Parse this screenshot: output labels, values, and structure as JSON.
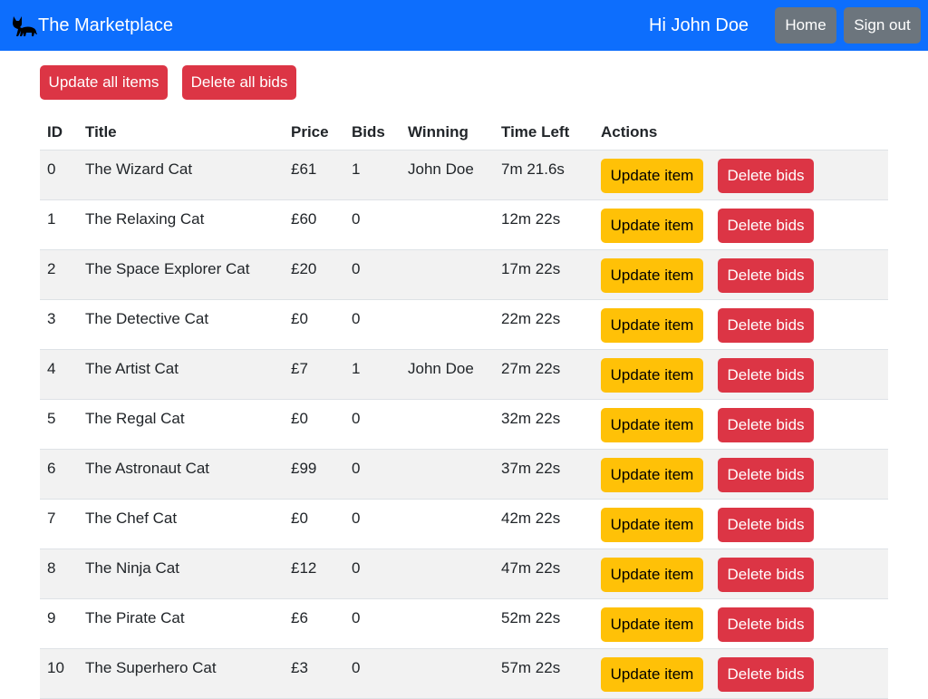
{
  "navbar": {
    "brand": "The Marketplace",
    "brand_icon": "cat-icon",
    "greeting": "Hi John Doe",
    "home_label": "Home",
    "signout_label": "Sign out",
    "color": "#0d6efd"
  },
  "toolbar": {
    "update_all_label": "Update all items",
    "delete_all_label": "Delete all bids"
  },
  "table": {
    "headers": [
      "ID",
      "Title",
      "Price",
      "Bids",
      "Winning",
      "Time Left",
      "Actions"
    ],
    "rows": [
      {
        "id": "0",
        "title": "The Wizard Cat",
        "price": "£61",
        "bids": "1",
        "winning": "John Doe",
        "time_left": "7m 21.6s"
      },
      {
        "id": "1",
        "title": "The Relaxing Cat",
        "price": "£60",
        "bids": "0",
        "winning": "",
        "time_left": "12m 22s"
      },
      {
        "id": "2",
        "title": "The Space Explorer Cat",
        "price": "£20",
        "bids": "0",
        "winning": "",
        "time_left": "17m 22s"
      },
      {
        "id": "3",
        "title": "The Detective Cat",
        "price": "£0",
        "bids": "0",
        "winning": "",
        "time_left": "22m 22s"
      },
      {
        "id": "4",
        "title": "The Artist Cat",
        "price": "£7",
        "bids": "1",
        "winning": "John Doe",
        "time_left": "27m 22s"
      },
      {
        "id": "5",
        "title": "The Regal Cat",
        "price": "£0",
        "bids": "0",
        "winning": "",
        "time_left": "32m 22s"
      },
      {
        "id": "6",
        "title": "The Astronaut Cat",
        "price": "£99",
        "bids": "0",
        "winning": "",
        "time_left": "37m 22s"
      },
      {
        "id": "7",
        "title": "The Chef Cat",
        "price": "£0",
        "bids": "0",
        "winning": "",
        "time_left": "42m 22s"
      },
      {
        "id": "8",
        "title": "The Ninja Cat",
        "price": "£12",
        "bids": "0",
        "winning": "",
        "time_left": "47m 22s"
      },
      {
        "id": "9",
        "title": "The Pirate Cat",
        "price": "£6",
        "bids": "0",
        "winning": "",
        "time_left": "52m 22s"
      },
      {
        "id": "10",
        "title": "The Superhero Cat",
        "price": "£3",
        "bids": "0",
        "winning": "",
        "time_left": "57m 22s"
      }
    ],
    "update_label": "Update item",
    "delete_label": "Delete bids"
  }
}
